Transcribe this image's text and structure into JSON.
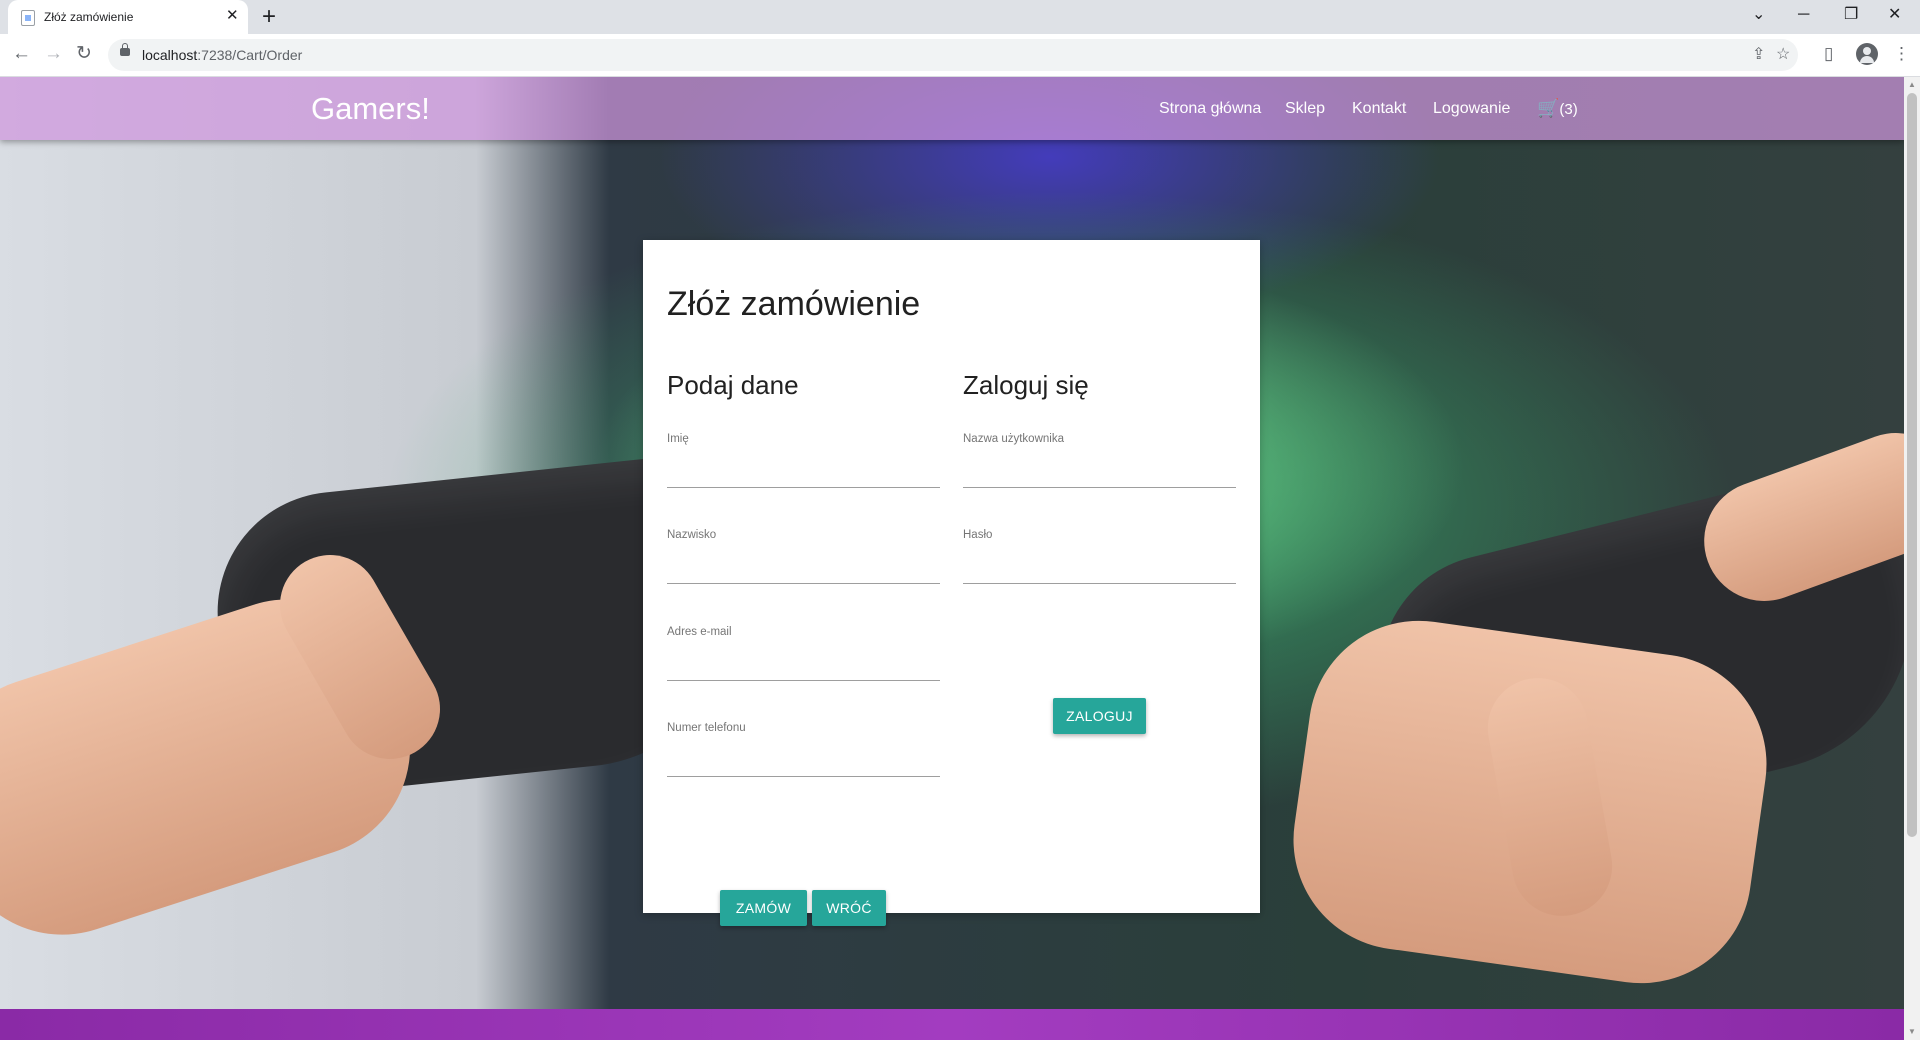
{
  "browser": {
    "tab_title": "Złóż zamówienie",
    "tab_close": "✕",
    "new_tab": "+",
    "url_host": "localhost",
    "url_path": ":7238/Cart/Order",
    "window_controls": [
      "⌄",
      "─",
      "❐",
      "✕"
    ]
  },
  "navbar": {
    "brand": "Gamers!",
    "links": [
      "Strona główna",
      "Sklep",
      "Kontakt",
      "Logowanie"
    ],
    "cart_count": "(3)"
  },
  "card": {
    "title": "Złóż zamówienie",
    "order_section": {
      "title": "Podaj dane",
      "fields": [
        {
          "label": "Imię",
          "value": ""
        },
        {
          "label": "Nazwisko",
          "value": ""
        },
        {
          "label": "Adres e-mail",
          "value": ""
        },
        {
          "label": "Numer telefonu",
          "value": ""
        }
      ],
      "order_button": "Zamów",
      "back_button": "Wróć"
    },
    "login_section": {
      "title": "Zaloguj się",
      "fields": [
        {
          "label": "Nazwa użytkownika",
          "value": ""
        },
        {
          "label": "Hasło",
          "value": ""
        }
      ],
      "login_button": "Zaloguj"
    }
  },
  "colors": {
    "navbar": "#ce96de",
    "button": "#26a69a",
    "footer": "#9a33b6"
  }
}
